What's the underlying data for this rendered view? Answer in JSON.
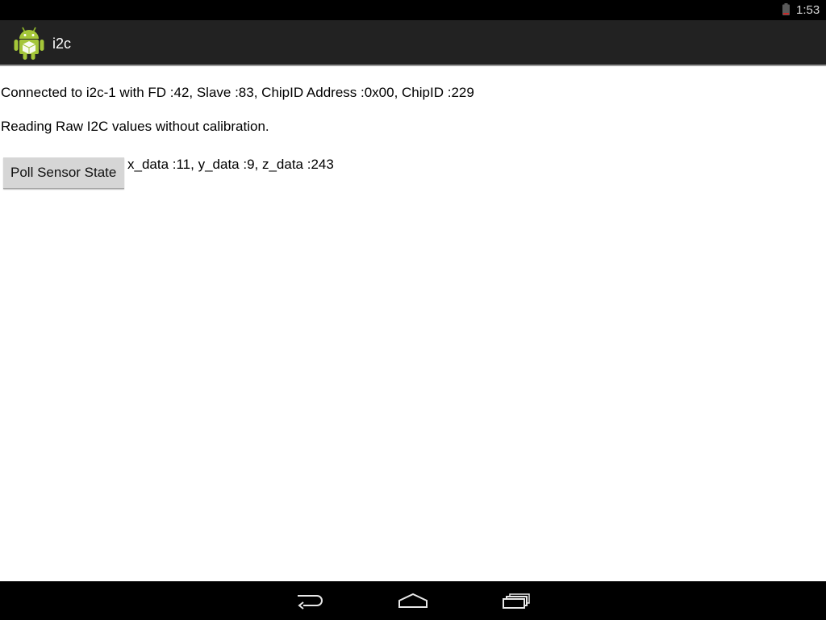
{
  "status_bar": {
    "time": "1:53",
    "icons": {
      "battery": "battery-icon"
    }
  },
  "action_bar": {
    "title": "i2c",
    "icon": "android-app-icon"
  },
  "main": {
    "connection_text": "Connected to i2c-1 with FD :42, Slave :83, ChipID Address :0x00, ChipID :229",
    "reading_text": "Reading Raw I2C values without calibration.",
    "poll_button_label": "Poll Sensor State",
    "sensor_values_text": "x_data :11, y_data :9, z_data :243"
  },
  "nav_bar": {
    "icons": [
      "back-icon",
      "home-icon",
      "recent-apps-icon"
    ]
  },
  "colors": {
    "status_bar_bg": "#000000",
    "action_bar_bg": "#222222",
    "content_bg": "#ffffff",
    "button_bg": "#d6d6d6",
    "android_green": "#a4c639"
  }
}
